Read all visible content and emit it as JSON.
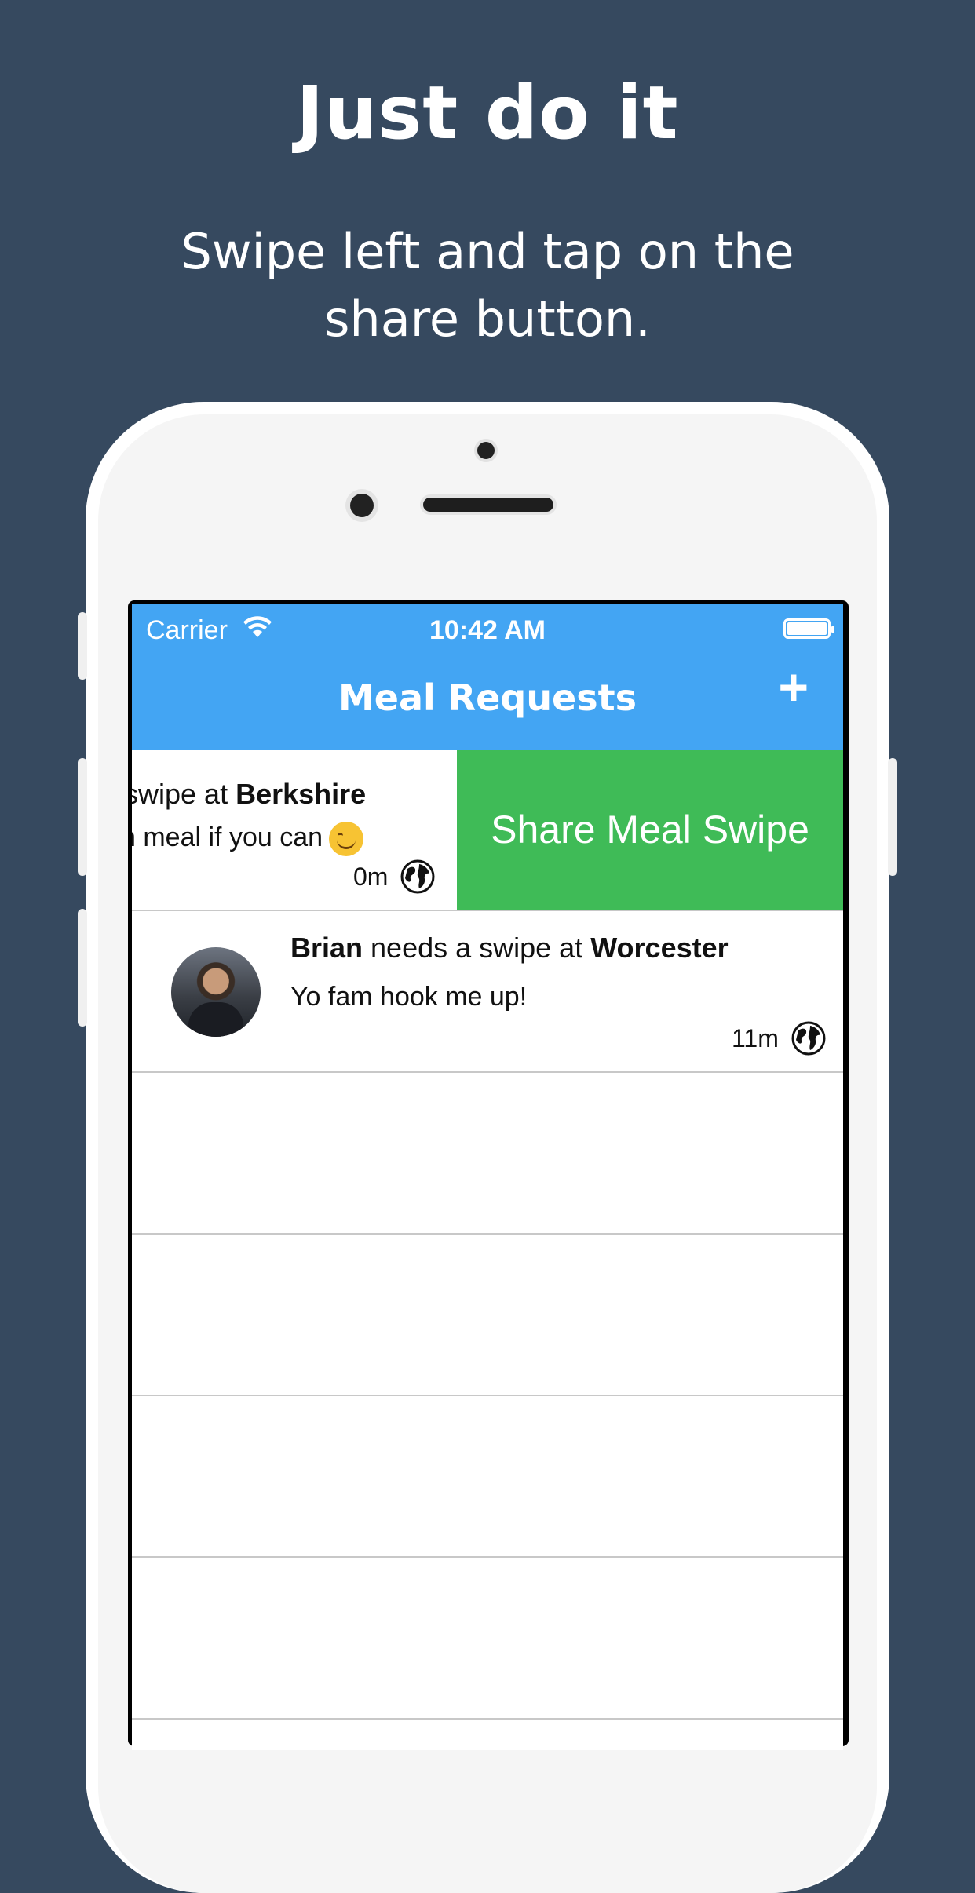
{
  "promo": {
    "headline": "Just do it",
    "subline": "Swipe left and tap on the share button."
  },
  "status_bar": {
    "carrier": "Carrier",
    "time": "10:42 AM"
  },
  "nav_bar": {
    "title": "Meal Requests",
    "add_label": "+"
  },
  "requests": [
    {
      "title_prefix": "swipe at ",
      "location": "Berkshire",
      "message": "n meal if you can",
      "time": "0m",
      "share_action": "Share Meal Swipe"
    },
    {
      "name": "Brian",
      "title_middle": " needs a swipe at ",
      "location": "Worcester",
      "message": "Yo fam hook me up!",
      "time": "11m"
    }
  ],
  "colors": {
    "background": "#36495f",
    "nav_bar": "#43a5f3",
    "share_action": "#3fbb57"
  }
}
